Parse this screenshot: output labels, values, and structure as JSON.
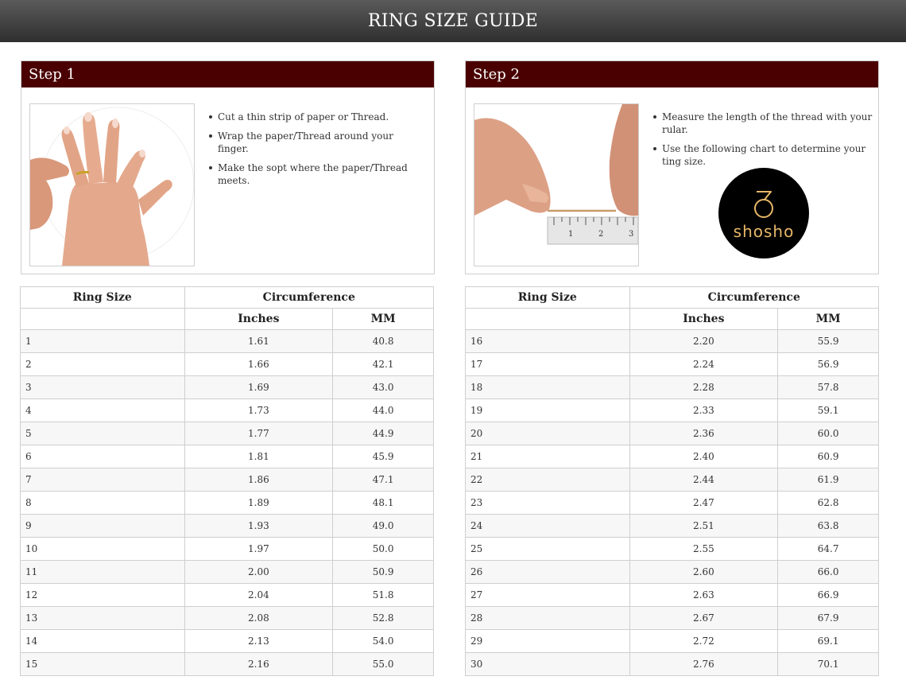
{
  "header": {
    "title": "RING SIZE GUIDE"
  },
  "step1": {
    "title": "Step 1",
    "bullets": [
      "Cut a thin strip of paper or Thread.",
      "Wrap the paper/Thread around your finger.",
      "Make the sopt where the paper/Thread meets."
    ]
  },
  "step2": {
    "title": "Step 2",
    "bullets": [
      "Measure the length of the thread with your rular.",
      "Use the following chart to determine your ting size."
    ],
    "logo_text": "shosho",
    "ruler_numbers": [
      "1",
      "2",
      "3"
    ]
  },
  "table": {
    "col_ring_size": "Ring Size",
    "col_circumference": "Circumference",
    "col_inches": "Inches",
    "col_mm": "MM",
    "left_rows": [
      [
        "1",
        "1.61",
        "40.8"
      ],
      [
        "2",
        "1.66",
        "42.1"
      ],
      [
        "3",
        "1.69",
        "43.0"
      ],
      [
        "4",
        "1.73",
        "44.0"
      ],
      [
        "5",
        "1.77",
        "44.9"
      ],
      [
        "6",
        "1.81",
        "45.9"
      ],
      [
        "7",
        "1.86",
        "47.1"
      ],
      [
        "8",
        "1.89",
        "48.1"
      ],
      [
        "9",
        "1.93",
        "49.0"
      ],
      [
        "10",
        "1.97",
        "50.0"
      ],
      [
        "11",
        "2.00",
        "50.9"
      ],
      [
        "12",
        "2.04",
        "51.8"
      ],
      [
        "13",
        "2.08",
        "52.8"
      ],
      [
        "14",
        "2.13",
        "54.0"
      ],
      [
        "15",
        "2.16",
        "55.0"
      ]
    ],
    "right_rows": [
      [
        "16",
        "2.20",
        "55.9"
      ],
      [
        "17",
        "2.24",
        "56.9"
      ],
      [
        "18",
        "2.28",
        "57.8"
      ],
      [
        "19",
        "2.33",
        "59.1"
      ],
      [
        "20",
        "2.36",
        "60.0"
      ],
      [
        "21",
        "2.40",
        "60.9"
      ],
      [
        "22",
        "2.44",
        "61.9"
      ],
      [
        "23",
        "2.47",
        "62.8"
      ],
      [
        "24",
        "2.51",
        "63.8"
      ],
      [
        "25",
        "2.55",
        "64.7"
      ],
      [
        "26",
        "2.60",
        "66.0"
      ],
      [
        "27",
        "2.63",
        "66.9"
      ],
      [
        "28",
        "2.67",
        "67.9"
      ],
      [
        "29",
        "2.72",
        "69.1"
      ],
      [
        "30",
        "2.76",
        "70.1"
      ]
    ]
  },
  "colors": {
    "header_bar": "#3a3a3a",
    "step_bar": "#4a0000",
    "logo_gold": "#e8b768"
  }
}
